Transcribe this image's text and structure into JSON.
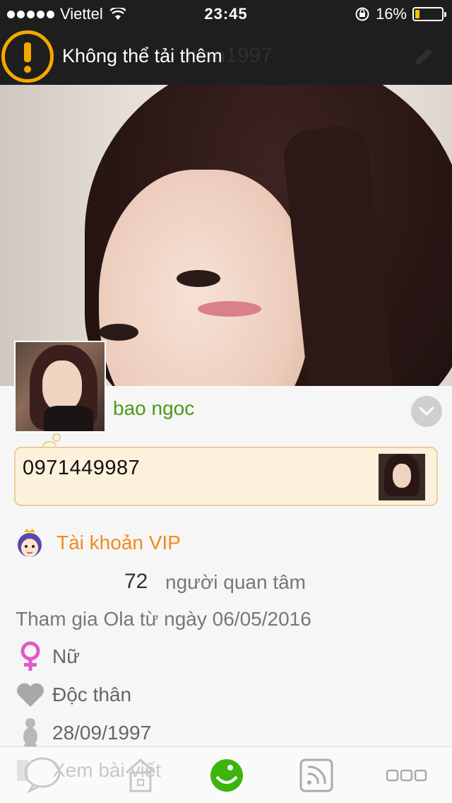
{
  "status_bar": {
    "carrier": "Viettel",
    "time": "23:45",
    "battery": "16%",
    "battery_level": 0.16
  },
  "header": {
    "title": "ntien1997"
  },
  "toast": {
    "message": "Không thể tải thêm"
  },
  "profile": {
    "username": "bao ngoc",
    "status_text": "0971449987",
    "vip_label": "Tài khoản VIP",
    "followers_count": "72",
    "followers_label": "người quan tâm",
    "joined": "Tham gia Ola từ ngày 06/05/2016",
    "gender": "Nữ",
    "relationship": "Độc thân",
    "birthday": "28/09/1997"
  },
  "tabbar": {
    "overlay_text": "Xem bài viết",
    "tabs": [
      {
        "icon": "chat-icon"
      },
      {
        "icon": "home-icon"
      },
      {
        "icon": "smiley-icon",
        "active": true
      },
      {
        "icon": "feed-icon"
      },
      {
        "icon": "more-icon"
      }
    ]
  },
  "colors": {
    "accent_green": "#4a9a1a",
    "vip_orange": "#f28b16",
    "toast_yellow": "#f5a800"
  }
}
